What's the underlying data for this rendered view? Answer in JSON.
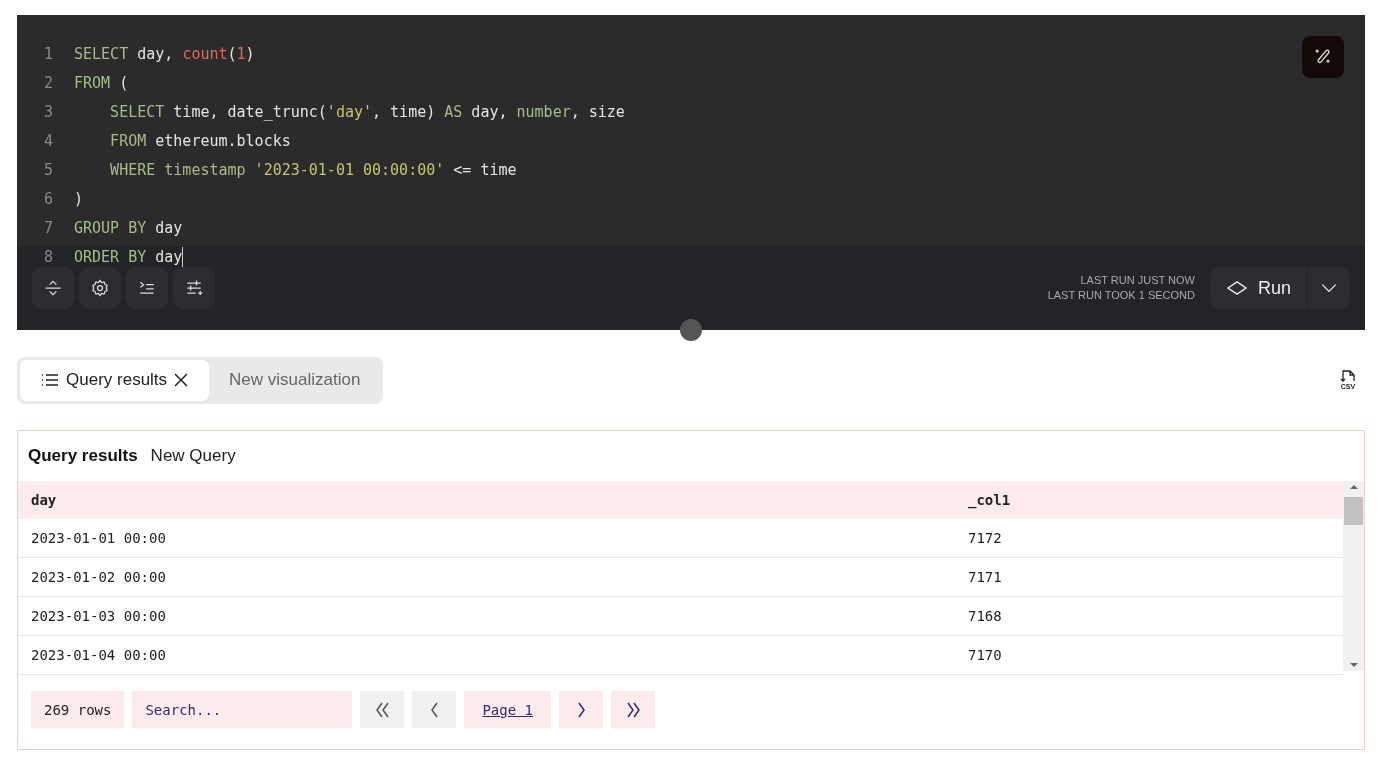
{
  "editor": {
    "lines": [
      {
        "number": "1",
        "indented": false,
        "tokens": [
          {
            "text": "SELECT",
            "kind": "keyword"
          },
          {
            "text": " day, ",
            "kind": "plain"
          },
          {
            "text": "count",
            "kind": "function"
          },
          {
            "text": "(",
            "kind": "plain"
          },
          {
            "text": "1",
            "kind": "number"
          },
          {
            "text": ")",
            "kind": "plain"
          }
        ]
      },
      {
        "number": "2",
        "indented": false,
        "tokens": [
          {
            "text": "FROM",
            "kind": "keyword"
          },
          {
            "text": " (",
            "kind": "plain"
          }
        ]
      },
      {
        "number": "3",
        "indented": true,
        "tokens": [
          {
            "text": "SELECT",
            "kind": "keyword"
          },
          {
            "text": " time, date_trunc(",
            "kind": "plain"
          },
          {
            "text": "'day'",
            "kind": "string"
          },
          {
            "text": ", time) ",
            "kind": "plain"
          },
          {
            "text": "AS",
            "kind": "keyword"
          },
          {
            "text": " day, ",
            "kind": "plain"
          },
          {
            "text": "number",
            "kind": "keyword"
          },
          {
            "text": ", size",
            "kind": "plain"
          }
        ]
      },
      {
        "number": "4",
        "indented": true,
        "tokens": [
          {
            "text": "FROM",
            "kind": "keyword"
          },
          {
            "text": " ethereum.blocks",
            "kind": "plain"
          }
        ]
      },
      {
        "number": "5",
        "indented": true,
        "tokens": [
          {
            "text": "WHERE",
            "kind": "keyword"
          },
          {
            "text": " timestamp",
            "kind": "keyword"
          },
          {
            "text": " '2023-01-01 00:00:00'",
            "kind": "string"
          },
          {
            "text": " <= time",
            "kind": "plain"
          }
        ]
      },
      {
        "number": "6",
        "indented": false,
        "tokens": [
          {
            "text": ")",
            "kind": "plain"
          }
        ]
      },
      {
        "number": "7",
        "indented": false,
        "tokens": [
          {
            "text": "GROUP BY",
            "kind": "keyword"
          },
          {
            "text": " day",
            "kind": "plain"
          }
        ]
      },
      {
        "number": "8",
        "indented": false,
        "tokens": [
          {
            "text": "ORDER BY",
            "kind": "keyword"
          },
          {
            "text": " day",
            "kind": "plain"
          }
        ]
      }
    ],
    "status": [
      "LAST RUN JUST NOW",
      "LAST RUN TOOK 1 SECOND"
    ],
    "run_button": "Run"
  },
  "tabs": [
    {
      "label": "Query results",
      "selected": true
    },
    {
      "label": "New visualization",
      "selected": false
    }
  ],
  "csv_icon_label": "CSV",
  "results": {
    "title": "Query results",
    "query_name": "New Query",
    "columns": [
      "day",
      "_col1"
    ],
    "rows": [
      [
        "2023-01-01 00:00",
        "7172"
      ],
      [
        "2023-01-02 00:00",
        "7171"
      ],
      [
        "2023-01-03 00:00",
        "7168"
      ],
      [
        "2023-01-04 00:00",
        "7170"
      ]
    ],
    "row_count": "269 rows",
    "search_placeholder": "Search...",
    "pager": [
      {
        "kind": "first",
        "disabled": true
      },
      {
        "kind": "prev",
        "disabled": true
      },
      {
        "kind": "page",
        "label": "Page 1",
        "disabled": false
      },
      {
        "kind": "next",
        "disabled": false
      },
      {
        "kind": "last",
        "disabled": false
      }
    ]
  }
}
